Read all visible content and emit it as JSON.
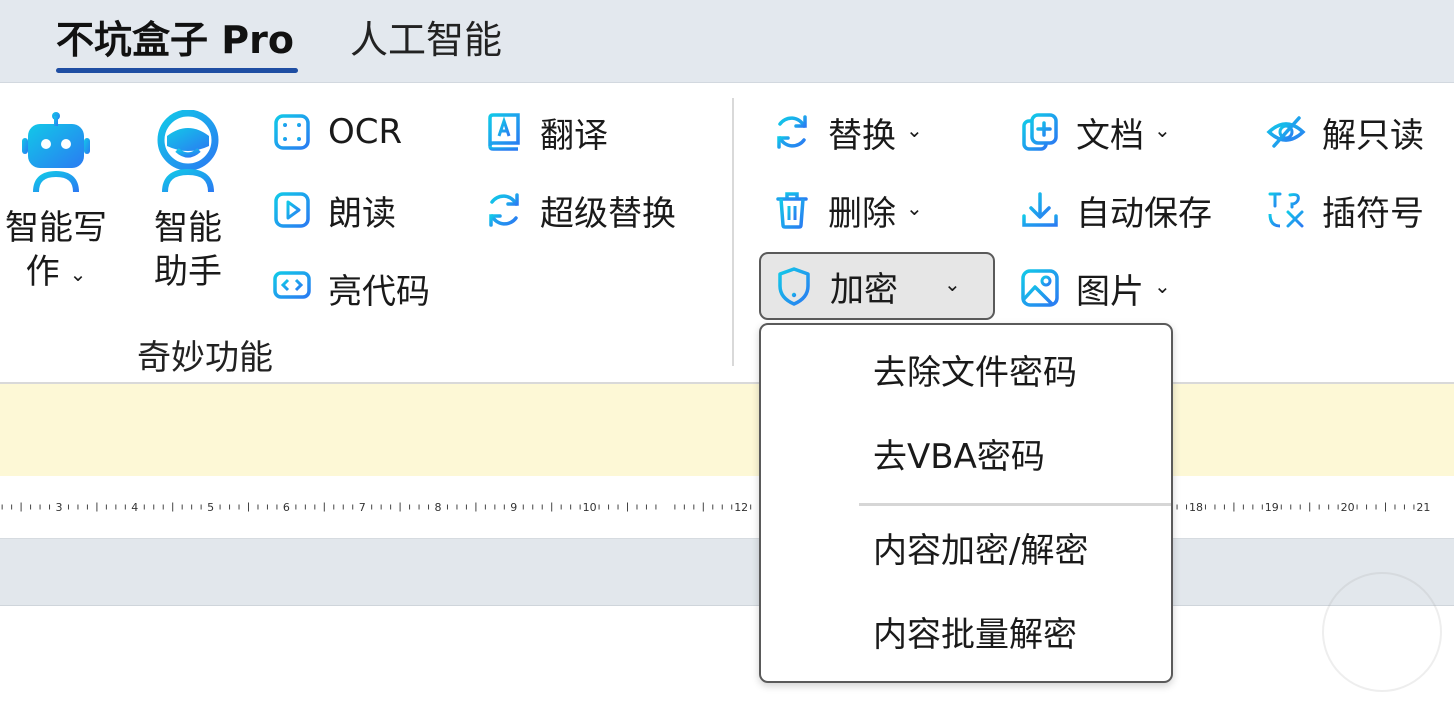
{
  "tabs": [
    {
      "label": "不坑盒子 Pro",
      "active": true
    },
    {
      "label": "人工智能",
      "active": false
    }
  ],
  "ribbon": {
    "ai_write": {
      "line1": "智能写",
      "line2": "作",
      "icon": "robot-icon"
    },
    "assistant": {
      "line1": "智能",
      "line2": "助手",
      "icon": "astronaut-icon"
    },
    "ocr": {
      "label": "OCR",
      "icon": "scan-frame-icon"
    },
    "read_aloud": {
      "label": "朗读",
      "icon": "play-icon"
    },
    "highlight_code": {
      "label": "亮代码",
      "icon": "code-monitor-icon"
    },
    "translate": {
      "label": "翻译",
      "icon": "book-a-icon"
    },
    "super_replace": {
      "label": "超级替换",
      "icon": "refresh-icon"
    },
    "group_label": "奇妙功能",
    "replace": {
      "label": "替换",
      "icon": "refresh-icon"
    },
    "delete": {
      "label": "删除",
      "icon": "trash-icon"
    },
    "encrypt": {
      "label": "加密",
      "icon": "shield-alert-icon"
    },
    "document": {
      "label": "文档",
      "icon": "file-add-icon"
    },
    "autosave": {
      "label": "自动保存",
      "icon": "download-icon"
    },
    "image": {
      "label": "图片",
      "icon": "image-icon"
    },
    "unlock_readonly": {
      "label": "解只读",
      "icon": "eye-off-icon"
    },
    "insert_symbol": {
      "label": "插符号",
      "icon": "symbols-icon"
    }
  },
  "ruler": {
    "labels": [
      "3",
      "4",
      "5",
      "6",
      "7",
      "8",
      "9",
      "10",
      "12",
      "18",
      "19",
      "20",
      "21"
    ]
  },
  "encrypt_menu": {
    "items": [
      {
        "label": "去除文件密码"
      },
      {
        "label": "去VBA密码"
      },
      {
        "label": "内容加密/解密"
      },
      {
        "label": "内容批量解密"
      }
    ]
  },
  "colors": {
    "accent_gradient_start": "#12c8e8",
    "accent_gradient_end": "#2a7bf2",
    "tab_underline": "#1f4ea3",
    "tabbar_bg": "#e3e8ee",
    "notice_bg": "#fdf8d6"
  }
}
